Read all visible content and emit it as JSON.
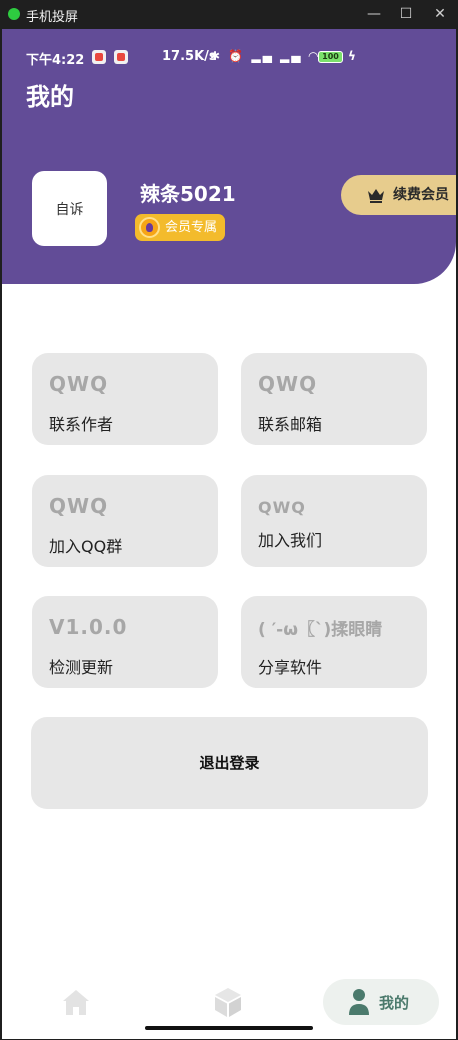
{
  "window": {
    "title": "手机投屏",
    "minimize": "—",
    "maximize": "☐",
    "close": "✕"
  },
  "status_bar": {
    "time": "下午4:22",
    "speed": "17.5K/s",
    "glyphs": "✱ ⏰ ▂▄ ▂▄ ◠",
    "battery": "100",
    "charging": "ϟ"
  },
  "header": {
    "title": "我的",
    "accent_color": "#624c97"
  },
  "profile": {
    "avatar_text": "自诉",
    "username": "辣条5021",
    "vip_badge": "会员专属",
    "renew_button": "续费会员"
  },
  "cards": [
    {
      "value": "QWQ",
      "label": "联系作者"
    },
    {
      "value": "QWQ",
      "label": "联系邮箱"
    },
    {
      "value": "QWQ",
      "label": "加入QQ群"
    },
    {
      "value": "QWQ",
      "label": "加入我们"
    },
    {
      "value": "V1.0.0",
      "label": "检测更新"
    },
    {
      "value": "( ′-ω〖`)揉眼睛",
      "label": "分享软件"
    }
  ],
  "logout_button": "退出登录",
  "bottom_nav": {
    "items": [
      {
        "icon": "home-icon",
        "label": ""
      },
      {
        "icon": "box-icon",
        "label": ""
      },
      {
        "icon": "person-icon",
        "label": "我的"
      }
    ],
    "active_color": "#4b7a6c"
  }
}
